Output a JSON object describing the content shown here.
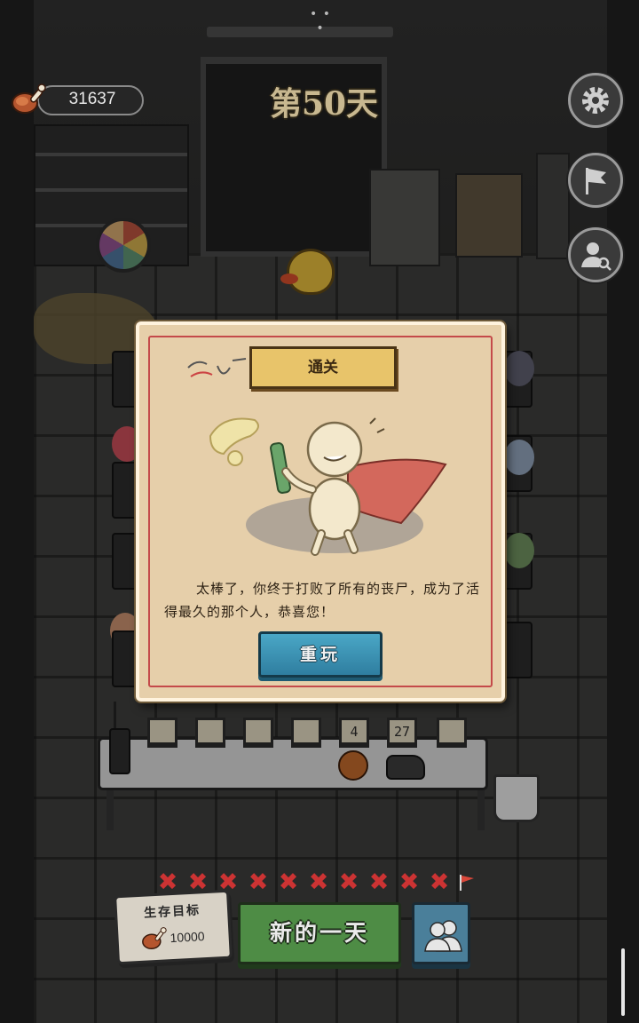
{
  "top_bar": {
    "more": "• • •",
    "meat_count": "31637",
    "day_title": "第50天"
  },
  "side_buttons": [
    {
      "name": "settings",
      "icon": "gear-icon"
    },
    {
      "name": "flag",
      "icon": "flag-icon"
    },
    {
      "name": "profile",
      "icon": "user-search-icon"
    }
  ],
  "desk": {
    "slot_values": [
      "",
      "",
      "",
      "",
      "4",
      "27",
      ""
    ]
  },
  "modal": {
    "title": "通关",
    "message": "太棒了，你终于打败了所有的丧尸，成为了活得最久的那个人，恭喜您！",
    "replay_label": "重玩"
  },
  "bottom_bar": {
    "goal_title": "生存目标",
    "goal_value": "10000",
    "new_day_label": "新的一天"
  },
  "colors": {
    "modal_paper": "#e6cfaa",
    "banner": "#e8c46a",
    "replay_button": "#3a92b4",
    "new_day_button": "#4e8c45",
    "people_button": "#4a7f9a",
    "x_marks": "#cc3333"
  }
}
